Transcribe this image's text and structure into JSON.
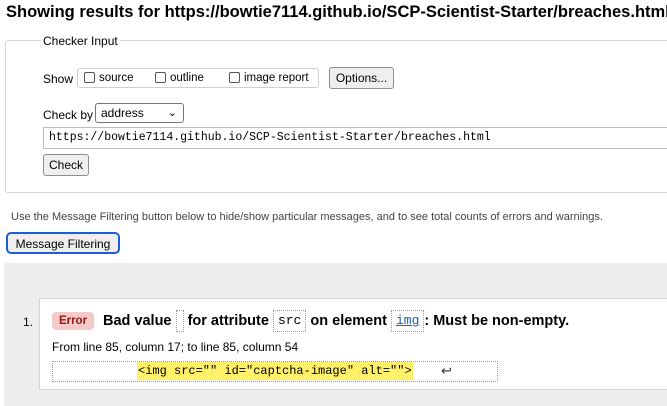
{
  "heading": "Showing results for https://bowtie7114.github.io/SCP-Scientist-Starter/breaches.html",
  "checker": {
    "legend": "Checker Input",
    "show_label": "Show",
    "options": [
      {
        "label": "source",
        "checked": false
      },
      {
        "label": "outline",
        "checked": false
      },
      {
        "label": "image report",
        "checked": false
      }
    ],
    "options_button": "Options...",
    "check_by_label": "Check by",
    "check_by_value": "address",
    "url_value": "https://bowtie7114.github.io/SCP-Scientist-Starter/breaches.html",
    "check_button": "Check"
  },
  "filter_note": "Use the Message Filtering button below to hide/show particular messages, and to see total counts of errors and warnings.",
  "message_filtering_button": "Message Filtering",
  "messages": [
    {
      "number": "1.",
      "type": "Error",
      "text_parts": [
        "Bad value",
        "for attribute",
        "src",
        "on element",
        "img",
        ": Must be non-empty."
      ],
      "location": "From line 85, column 17; to line 85, column 54",
      "extract": "<img src=\"\" id=\"captcha-image\" alt=\"\">",
      "return_symbol": "↩"
    }
  ]
}
